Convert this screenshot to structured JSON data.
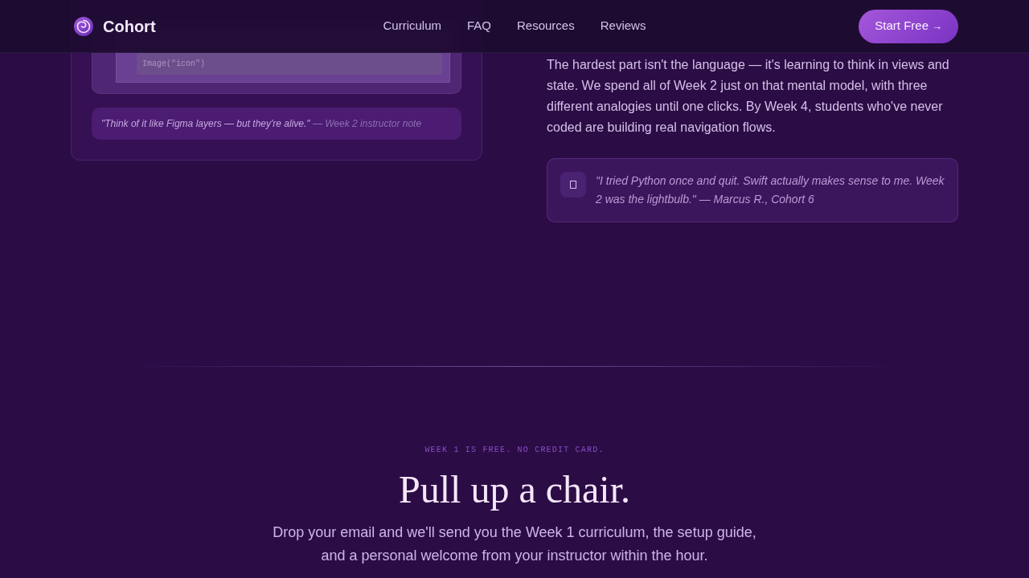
{
  "nav": {
    "brand": "Cohort",
    "links": [
      "Curriculum",
      "FAQ",
      "Resources",
      "Reviews"
    ],
    "cta": {
      "label": "Start Free",
      "arrow": "→"
    }
  },
  "code_preview": {
    "code_line": "Image(\"icon\")",
    "note": {
      "quote": "\"Think of it like Figma layers — but they're alive.\"",
      "attribution": "— Week 2 instructor note"
    }
  },
  "lesson": {
    "paragraph": "The hardest part isn't the language — it's learning to think in views and state. We spend all of Week 2 just on that mental model, with three different analogies until one clicks. By Week 4, students who've never coded are building real navigation flows.",
    "testimonial": "\"I tried Python once and quit. Swift actually makes sense to me. Week 2 was the lightbulb.\" — Marcus R., Cohort 6"
  },
  "signup": {
    "eyebrow": "WEEK 1 IS FREE. NO CREDIT CARD.",
    "heading": "Pull up a chair.",
    "body": "Drop your email and we'll send you the Week 1 curriculum, the setup guide, and a personal welcome from your instructor within the hour."
  }
}
